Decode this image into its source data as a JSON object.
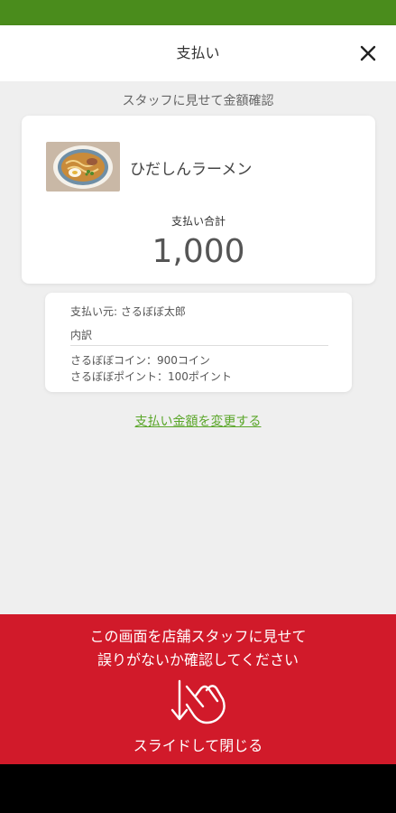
{
  "header": {
    "title": "支払い",
    "close_icon": "close-icon"
  },
  "instruction": "スタッフに見せて金額確認",
  "product": {
    "name": "ひだしんラーメン",
    "image_icon": "ramen-image"
  },
  "payment": {
    "total_label": "支払い合計",
    "total_amount": "1,000"
  },
  "details": {
    "payer": "支払い元:  さるぼぼ太郎",
    "breakdown_label": "内訳",
    "coin_line": "さるぼぼコイン：900コイン",
    "point_line": "さるぼぼポイント：100ポイント"
  },
  "change_amount_link": "支払い金額を変更する",
  "bottom": {
    "message_line1": "この画面を店舗スタッフに見せて",
    "message_line2": "誤りがないか確認してください",
    "slide_label": "スライドして閉じる",
    "swipe_icon": "swipe-down-hand-icon"
  },
  "colors": {
    "status_bar": "#4a8c1c",
    "accent_green": "#5aa629",
    "bottom_red": "#d11a2a",
    "background": "#efefef"
  }
}
